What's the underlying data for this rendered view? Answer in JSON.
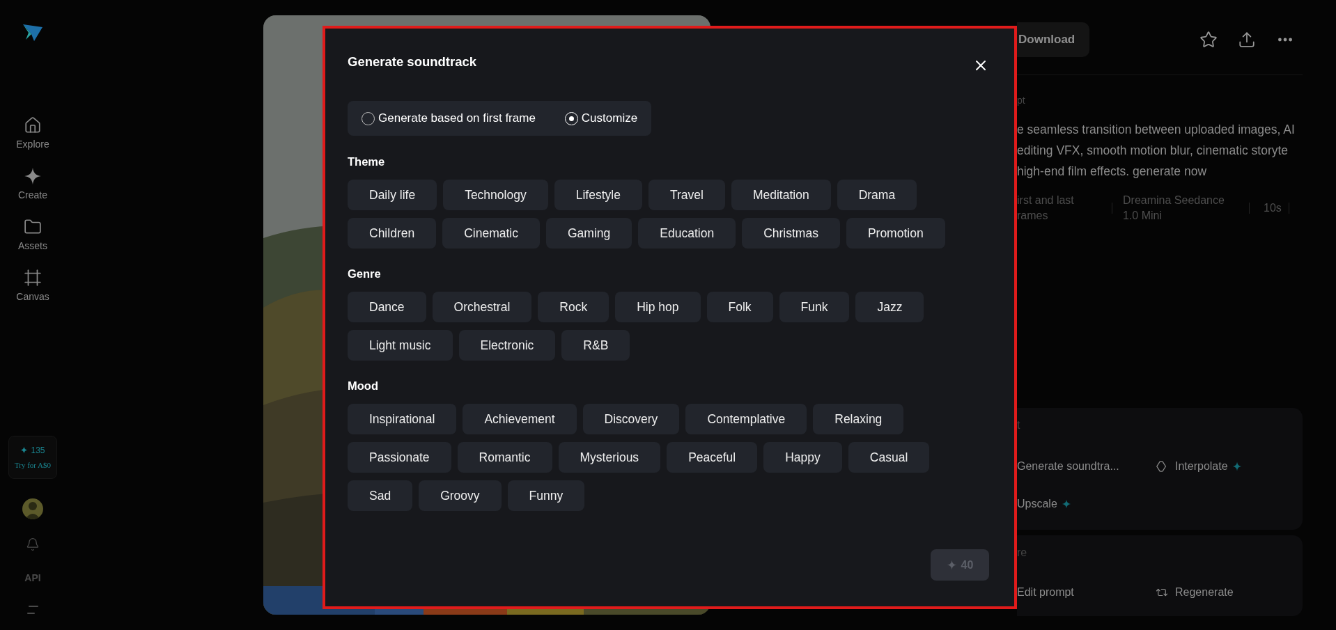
{
  "sidebar": {
    "nav": [
      {
        "label": "Explore"
      },
      {
        "label": "Create"
      },
      {
        "label": "Assets"
      },
      {
        "label": "Canvas"
      }
    ],
    "credits": {
      "count": "135",
      "offer": "Try for A$0"
    },
    "api": "API"
  },
  "detail_panel": {
    "download": "Download",
    "prompt_label": "pt",
    "prompt_lines": [
      "e seamless transition between uploaded images, AI",
      "editing VFX, smooth motion blur, cinematic storyte",
      "high-end film effects. generate now"
    ],
    "meta": [
      [
        "irst and last",
        "rames"
      ],
      [
        "Dreamina Seedance",
        "1.0 Mini"
      ],
      [
        "10s"
      ]
    ],
    "cards": [
      {
        "title": "t",
        "actions": [
          {
            "label": "Generate soundtra...",
            "premium": false
          },
          {
            "label": "Interpolate",
            "premium": true
          },
          {
            "label": "Upscale",
            "premium": true
          }
        ]
      },
      {
        "title": "re",
        "actions": [
          {
            "label": "Edit prompt",
            "premium": false
          },
          {
            "label": "Regenerate",
            "premium": false
          }
        ]
      }
    ]
  },
  "dialog": {
    "title": "Generate soundtrack",
    "modes": [
      {
        "label": "Generate based on first frame",
        "selected": false
      },
      {
        "label": "Customize",
        "selected": true
      }
    ],
    "sections": [
      {
        "title": "Theme",
        "chips": [
          "Daily life",
          "Technology",
          "Lifestyle",
          "Travel",
          "Meditation",
          "Drama",
          "Children",
          "Cinematic",
          "Gaming",
          "Education",
          "Christmas",
          "Promotion"
        ]
      },
      {
        "title": "Genre",
        "chips": [
          "Dance",
          "Orchestral",
          "Rock",
          "Hip hop",
          "Folk",
          "Funk",
          "Jazz",
          "Light music",
          "Electronic",
          "R&B"
        ]
      },
      {
        "title": "Mood",
        "chips": [
          "Inspirational",
          "Achievement",
          "Discovery",
          "Contemplative",
          "Relaxing",
          "Passionate",
          "Romantic",
          "Mysterious",
          "Peaceful",
          "Happy",
          "Casual",
          "Sad",
          "Groovy",
          "Funny"
        ]
      }
    ],
    "submit": {
      "cost": "40",
      "disabled": true
    }
  }
}
